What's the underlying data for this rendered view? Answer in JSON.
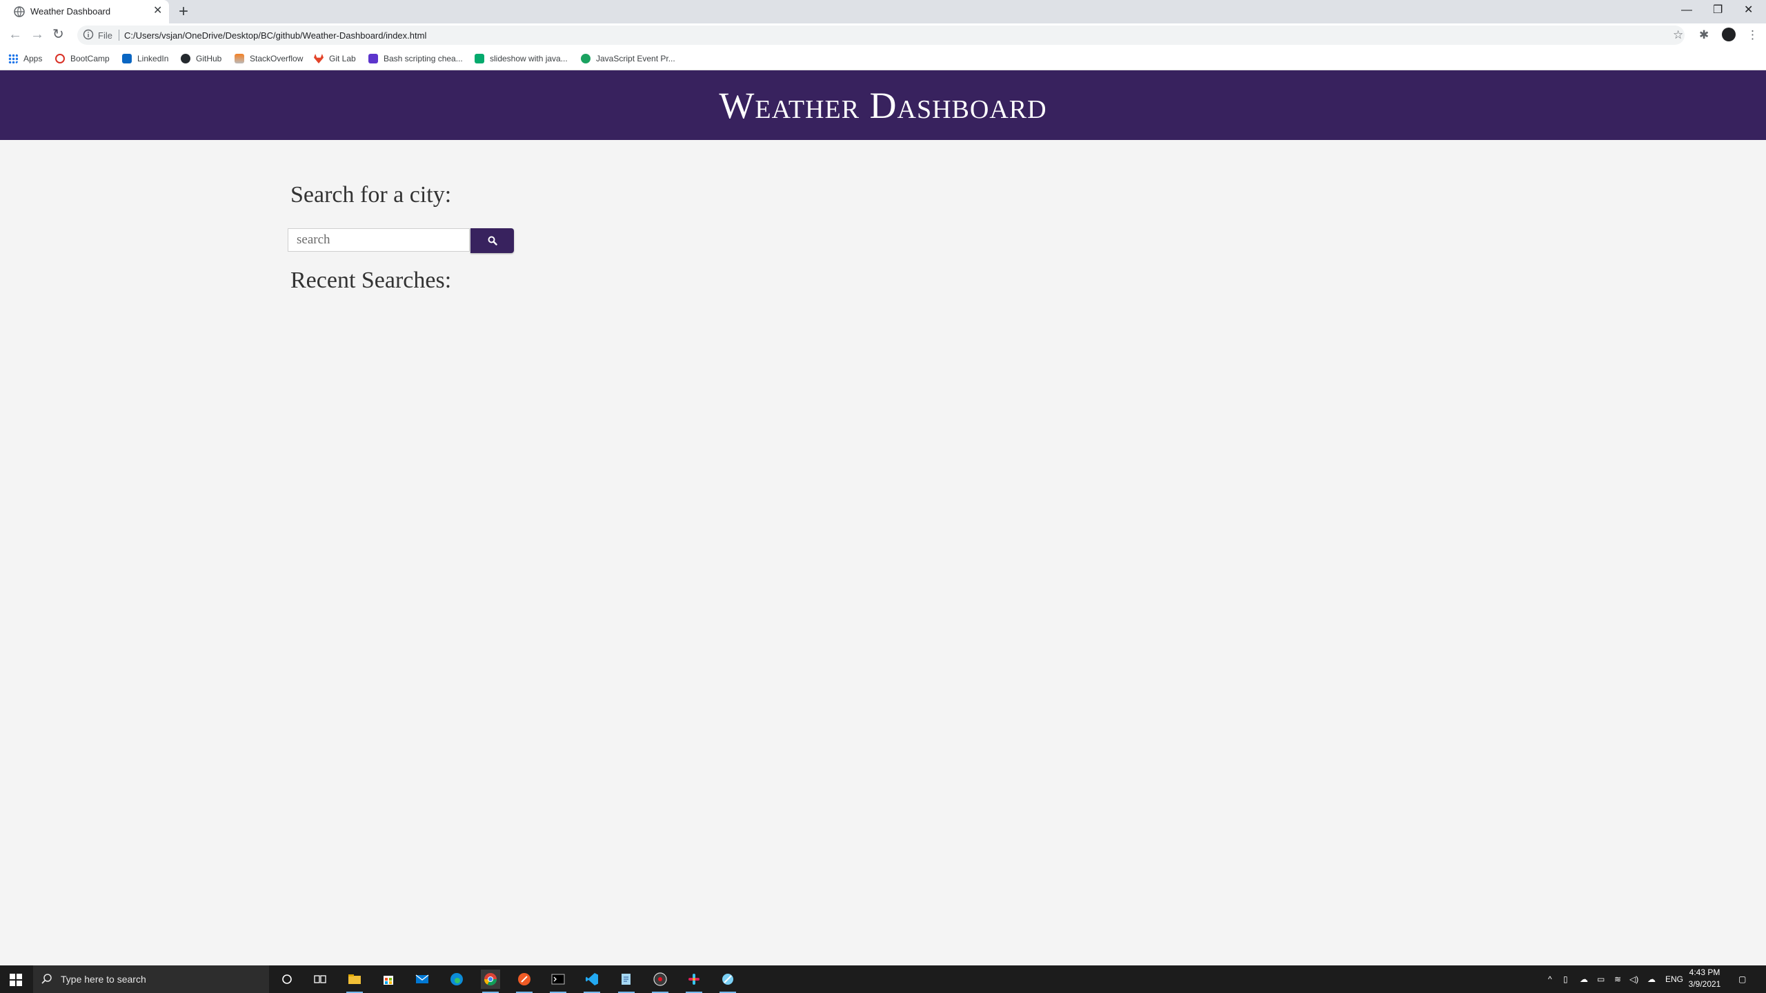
{
  "browser": {
    "tab_title": "Weather Dashboard",
    "new_tab_label": "+",
    "address_scheme_label": "File",
    "url": "C:/Users/vsjan/OneDrive/Desktop/BC/github/Weather-Dashboard/index.html",
    "bookmarks": [
      {
        "label": "Apps",
        "icon": "apps-grid-icon",
        "color": "#1a73e8"
      },
      {
        "label": "BootCamp",
        "icon": "bootcamp-icon",
        "color": "#d93025"
      },
      {
        "label": "LinkedIn",
        "icon": "linkedin-icon",
        "color": "#0a66c2"
      },
      {
        "label": "GitHub",
        "icon": "github-icon",
        "color": "#24292e"
      },
      {
        "label": "StackOverflow",
        "icon": "stackoverflow-icon",
        "color": "#f48024"
      },
      {
        "label": "Git Lab",
        "icon": "gitlab-icon",
        "color": "#e24329"
      },
      {
        "label": "Bash scripting chea...",
        "icon": "bash-icon",
        "color": "#5c35cc"
      },
      {
        "label": "slideshow with java...",
        "icon": "w3schools-icon",
        "color": "#04aa6d"
      },
      {
        "label": "JavaScript Event Pr...",
        "icon": "js-event-icon",
        "color": "#1aa260"
      }
    ]
  },
  "page": {
    "header_title": "Weather Dashboard",
    "search_heading": "Search for a city:",
    "search_placeholder": "search",
    "search_button_icon": "search-icon",
    "recent_heading": "Recent Searches:",
    "accent_color": "#38225e",
    "background_color": "#f4f4f4"
  },
  "taskbar": {
    "search_placeholder": "Type here to search",
    "language": "ENG",
    "time": "4:43 PM",
    "date": "3/9/2021"
  }
}
